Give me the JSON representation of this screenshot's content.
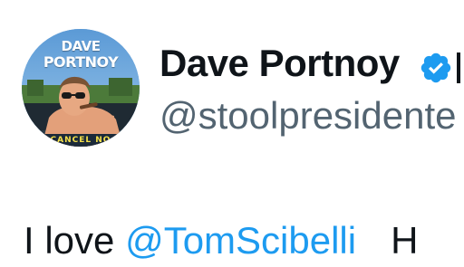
{
  "profile": {
    "avatar_text_first": "DAVE",
    "avatar_text_last": "PORTNOY",
    "avatar_text_bottom": "CANCEL NO",
    "display_name": "Dave Portnoy",
    "handle": "@stoolpresidente",
    "verified_icon": "verified-badge-icon"
  },
  "tweet": {
    "text_prefix": "I love ",
    "mention": "@TomScibelli",
    "text_continuation": "H"
  },
  "colors": {
    "name": "#0f1419",
    "handle": "#536471",
    "mention": "#1d9bf0",
    "verified_badge": "#1d9bf0"
  }
}
